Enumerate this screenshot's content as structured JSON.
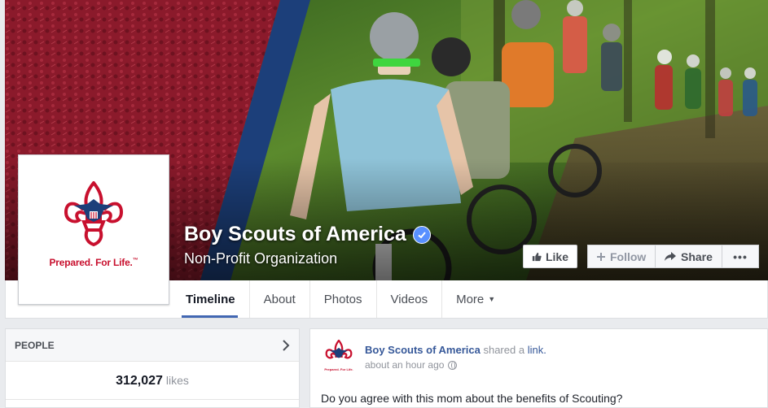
{
  "page": {
    "name": "Boy Scouts of America",
    "category": "Non-Profit Organization",
    "motto": "Prepared. For Life.",
    "motto_mark": "™"
  },
  "actions": {
    "like": "Like",
    "follow": "Follow",
    "share": "Share",
    "more": "•••"
  },
  "tabs": [
    {
      "label": "Timeline",
      "active": true
    },
    {
      "label": "About"
    },
    {
      "label": "Photos"
    },
    {
      "label": "Videos"
    },
    {
      "label": "More"
    }
  ],
  "people": {
    "heading": "PEOPLE",
    "likes_count": "312,027",
    "likes_label": "likes"
  },
  "post": {
    "author": "Boy Scouts of America",
    "action": "shared a",
    "link_text": "link.",
    "time": "about an hour ago",
    "text": "Do you agree with this mom about the benefits of Scouting?"
  },
  "colors": {
    "facebook_blue": "#4267b2",
    "link_blue": "#365899",
    "bsa_red": "#c8102e",
    "bsa_navy": "#1c3f7a",
    "verified_blue": "#5890ff"
  },
  "icons": [
    "verified-badge-icon",
    "thumbs-up-icon",
    "plus-icon",
    "share-arrow-icon",
    "ellipsis-icon",
    "chevron-right-icon",
    "caret-down-icon",
    "globe-icon",
    "fleur-de-lis-logo"
  ]
}
